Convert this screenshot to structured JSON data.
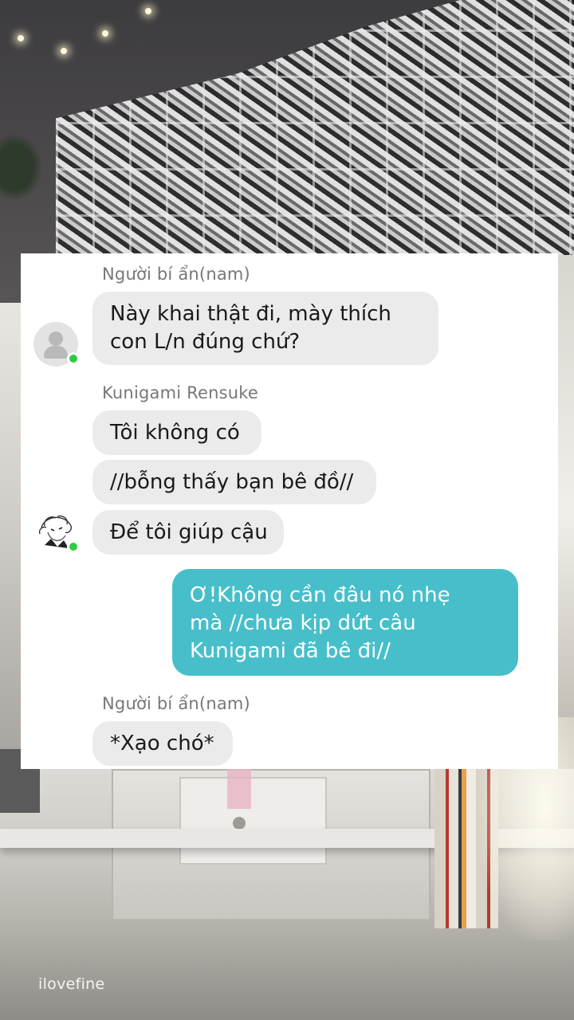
{
  "chat": {
    "groups": [
      {
        "sender": "Người bí ẩn(nam)",
        "messages": [
          "Này khai thật đi, mày thích con L/n đúng chứ?"
        ]
      },
      {
        "sender": "Kunigami Rensuke",
        "messages": [
          "Tôi không có",
          "//bỗng thấy bạn bê đồ//",
          "Để tôi giúp cậu"
        ]
      },
      {
        "sender": "",
        "messages": [
          "Ơ!Không cần đâu nó nhẹ mà //chưa kịp dứt câu Kunigami đã bê đi//"
        ]
      },
      {
        "sender": "Người bí ẩn(nam)",
        "messages": [
          "*Xạo chó*"
        ]
      }
    ],
    "lines": {
      "g0_m0_l1": "Này khai thật đi, mày thích",
      "g0_m0_l2": "con L/n đúng chứ?",
      "g2_m0_l1": "Ơ!Không cần đâu nó nhẹ",
      "g2_m0_l2": "mà //chưa kịp dứt câu",
      "g2_m0_l3": "Kunigami đã bê đi//"
    },
    "avatars": {
      "stranger": "default-person-icon",
      "kunigami": "sketch-avatar-icon"
    },
    "status": {
      "online_color": "#2ecc40"
    },
    "colors": {
      "incoming": "#ebebeb",
      "outgoing": "#47bfca"
    }
  },
  "watermark": "ilovefine"
}
